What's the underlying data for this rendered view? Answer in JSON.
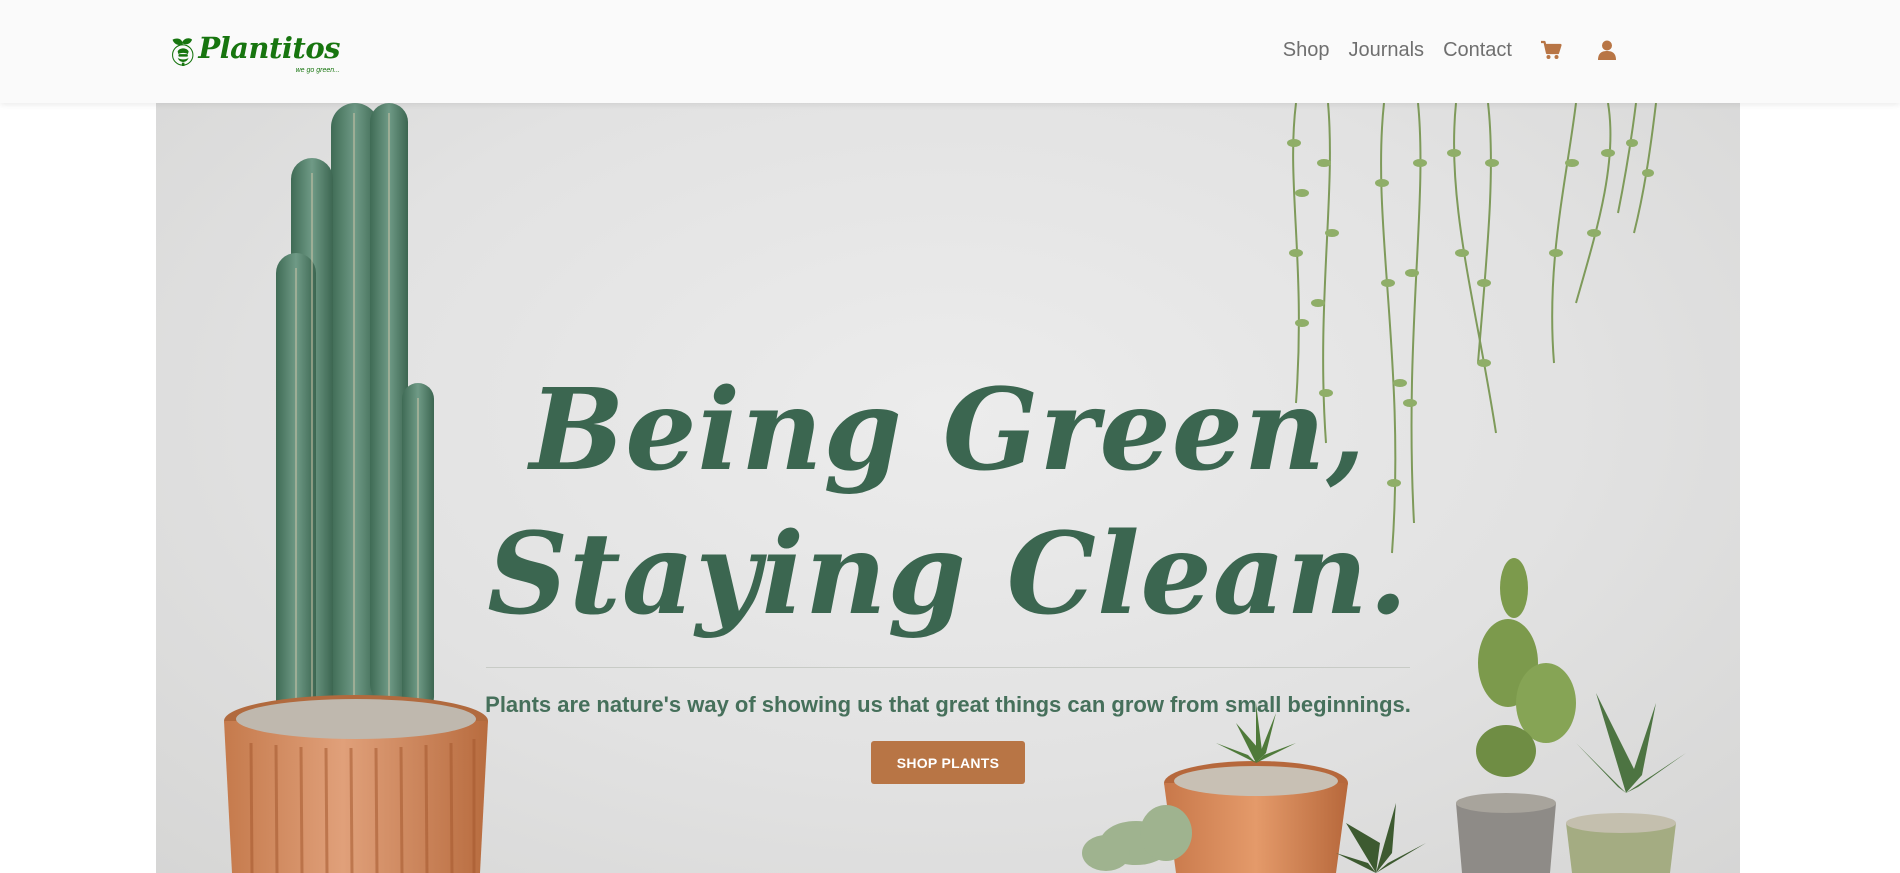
{
  "brand": {
    "name": "Plantitos",
    "tagline": "we go green..."
  },
  "nav": {
    "links": [
      "Shop",
      "Journals",
      "Contact"
    ],
    "cart_icon": "shopping-cart-icon",
    "account_icon": "user-icon"
  },
  "hero": {
    "title_line1": "Being Green,",
    "title_line2": "Staying Clean.",
    "subtitle": "Plants are nature's way of showing us that great things can grow from small beginnings.",
    "cta_label": "SHOP PLANTS"
  },
  "colors": {
    "brand_green": "#17750f",
    "title_green": "#3b6650",
    "accent_orange": "#b87545",
    "nav_text": "#6f6f6f"
  }
}
